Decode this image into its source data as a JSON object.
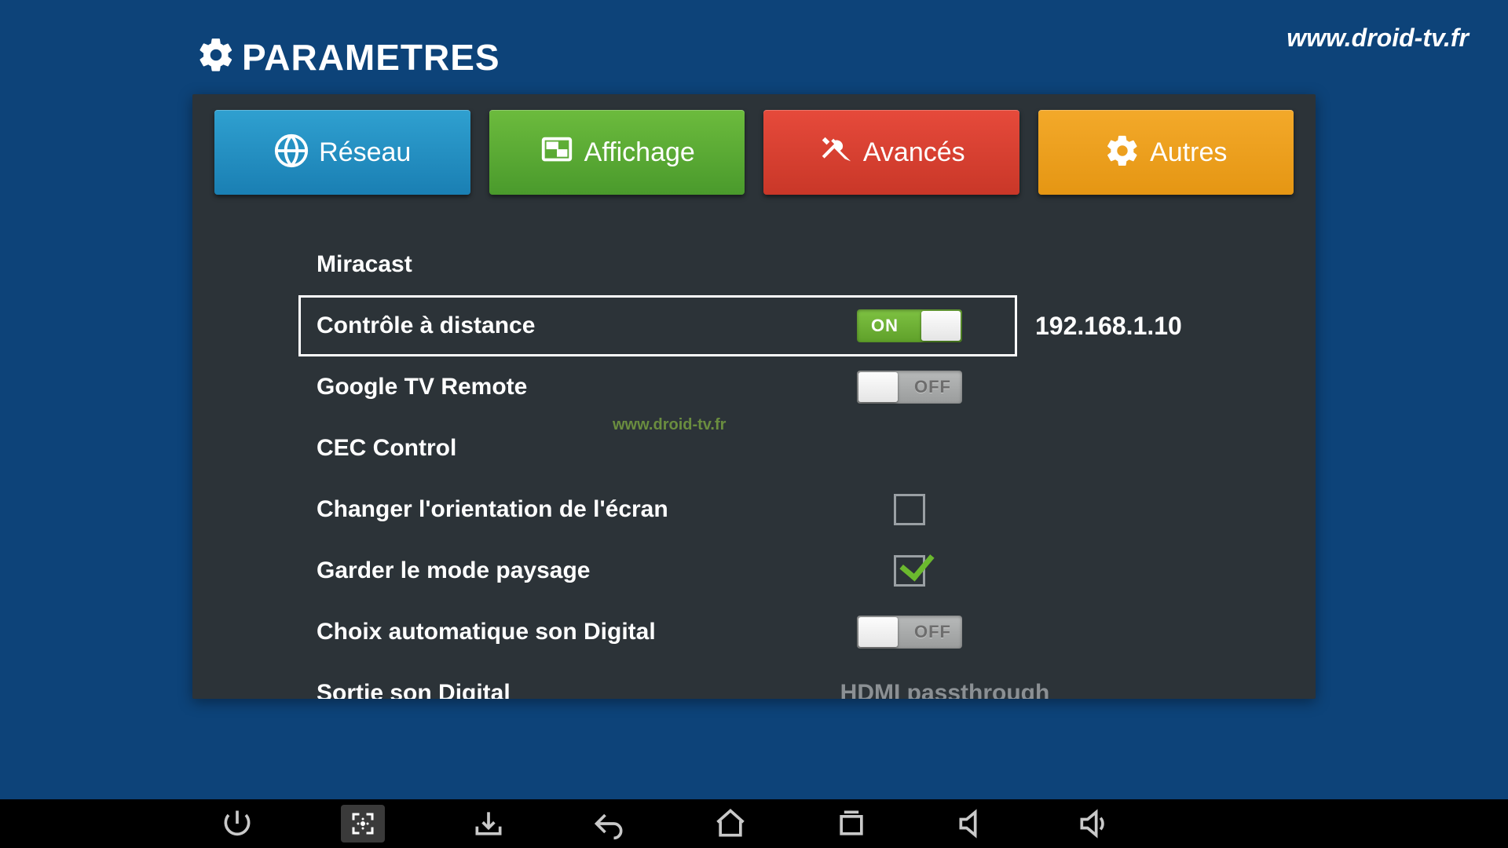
{
  "header": {
    "title": "PARAMETRES",
    "url": "www.droid-tv.fr"
  },
  "tabs": {
    "network": "Réseau",
    "display": "Affichage",
    "advanced": "Avancés",
    "other": "Autres"
  },
  "settings": {
    "miracast_label": "Miracast",
    "remote_label": "Contrôle à distance",
    "remote_ip": "192.168.1.10",
    "google_tv_label": "Google TV Remote",
    "cec_label": "CEC Control",
    "orientation_label": "Changer l'orientation de l'écran",
    "landscape_label": "Garder le mode paysage",
    "auto_digital_label": "Choix automatique son Digital",
    "digital_out_label": "Sortie son Digital",
    "digital_out_value": "HDMI passthrough",
    "on_text": "ON",
    "off_text": "OFF",
    "remote_state": "on",
    "google_tv_state": "off",
    "orientation_checked": false,
    "landscape_checked": true,
    "auto_digital_state": "off"
  },
  "watermark": "www.droid-tv.fr"
}
